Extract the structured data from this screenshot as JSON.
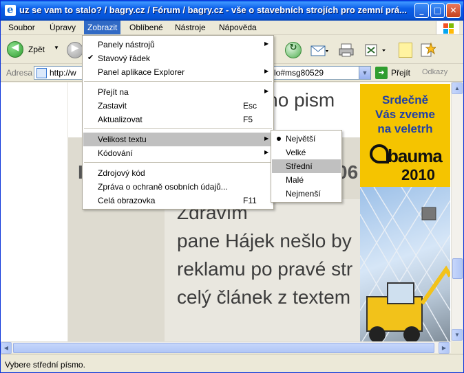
{
  "window": {
    "title": "uz se vam to stalo? / bagry.cz / Fórum / bagry.cz - vše o stavebních strojích pro zemní prá...",
    "controls": {
      "minimize": "_",
      "maximize": "□",
      "close": "✕"
    }
  },
  "menubar": {
    "items": [
      "Soubor",
      "Úpravy",
      "Zobrazit",
      "Oblíbené",
      "Nástroje",
      "Nápověda"
    ],
    "active": "Zobrazit"
  },
  "toolbar": {
    "back_label": "Zpět"
  },
  "address": {
    "label": "Adresa",
    "url_visible_start": "http://w",
    "url_visible_end": "lo#msg80529",
    "go_label": "Přejít",
    "links_label": "Odkazy"
  },
  "page": {
    "line_partial": "edno pism",
    "year_fragment": "06",
    "text_lines": [
      "Zdravím",
      "pane Hájek nešlo by",
      "reklamu po pravé str",
      "celý článek z textem"
    ],
    "ad": {
      "line1": "Srdečně",
      "line2": "Vás zveme",
      "line3": "na veletrh",
      "brand": "bauma",
      "year": "2010"
    }
  },
  "view_menu": {
    "items": [
      {
        "label": "Panely nástrojů",
        "arrow": "▶"
      },
      {
        "label": "Stavový řádek",
        "check": "✔"
      },
      {
        "label": "Panel aplikace Explorer",
        "arrow": "▶"
      },
      {
        "label": "Přejít na",
        "arrow": "▶"
      },
      {
        "label": "Zastavit",
        "shortcut": "Esc"
      },
      {
        "label": "Aktualizovat",
        "shortcut": "F5"
      },
      {
        "label": "Velikost textu",
        "arrow": "▶"
      },
      {
        "label": "Kódování",
        "arrow": "▶"
      },
      {
        "label": "Zdrojový kód"
      },
      {
        "label": "Zpráva o ochraně osobních údajů..."
      },
      {
        "label": "Celá obrazovka",
        "shortcut": "F11"
      }
    ]
  },
  "text_size_menu": {
    "items": [
      "Největší",
      "Velké",
      "Střední",
      "Malé",
      "Nejmenší"
    ],
    "selected": "Největší",
    "highlighted": "Střední"
  },
  "statusbar": {
    "text": "Vybere střední písmo."
  },
  "colors": {
    "titlebar": "#0a5ee8",
    "menu_highlight": "#c0c0c0",
    "ad_background": "#f5c400",
    "ad_text": "#1f3fa8"
  }
}
